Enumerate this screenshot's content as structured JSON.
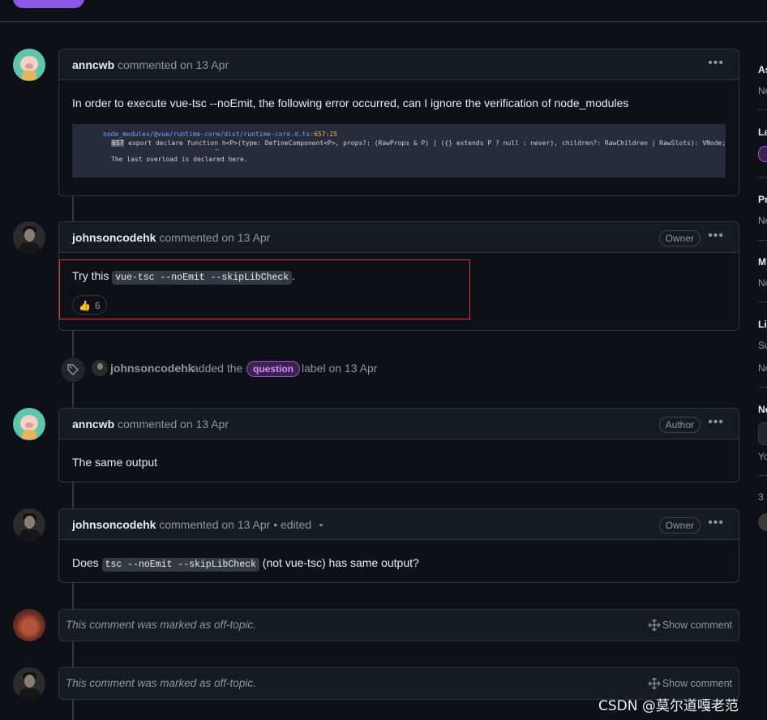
{
  "comments": [
    {
      "author": "anncwb",
      "meta": "commented on 13 Apr",
      "body": "In order to execute vue-tsc --noEmit, the following error occurred, can I ignore the verification of node_modules",
      "screenshot": {
        "path": "node_modules/@vue/runtime-core/dist/runtime-core.d.ts:",
        "line": "657:25",
        "lineno": "657",
        "code_line": " export declare function h<P>(type: DefineComponent<P>, props?: (RawProps & P) | ({} extends P ? null : never), children?: RawChildren | RawSlots): VNode;",
        "caret": "~",
        "note": "The last overload is declared here."
      }
    },
    {
      "author": "johnsoncodehk",
      "meta": "commented on 13 Apr",
      "badge": "Owner",
      "body_prefix": "Try this ",
      "body_code": "vue-tsc --noEmit --skipLibCheck",
      "body_suffix": ".",
      "reaction": {
        "emoji": "👍",
        "count": "6"
      }
    },
    {
      "author": "anncwb",
      "meta": "commented on 13 Apr",
      "badge": "Author",
      "body": "The same output"
    },
    {
      "author": "johnsoncodehk",
      "meta": "commented on 13 Apr • edited",
      "badge": "Owner",
      "body_prefix": "Does ",
      "body_code": "tsc --noEmit --skipLibCheck",
      "body_suffix": " (not vue-tsc) has same output?"
    }
  ],
  "label_event": {
    "actor": "johnsoncodehk",
    "action": "added the",
    "label": "question",
    "suffix": "label on 13 Apr",
    "label_color": "#d98bff"
  },
  "offtopic": [
    {
      "text": "This comment was marked as off-topic.",
      "action": "Show comment"
    },
    {
      "text": "This comment was marked as off-topic.",
      "action": "Show comment"
    }
  ],
  "kebab": "•••",
  "sidebar": [
    "As",
    "No",
    "La",
    "Pr",
    "No",
    "M",
    "No",
    "Li",
    "Su",
    "No",
    "No",
    "Yo",
    "3"
  ],
  "watermark": "CSDN @莫尔道嘎老范",
  "colors": {
    "background": "#0d1117",
    "highlight": "#d93737",
    "accent": "#8957e5"
  }
}
